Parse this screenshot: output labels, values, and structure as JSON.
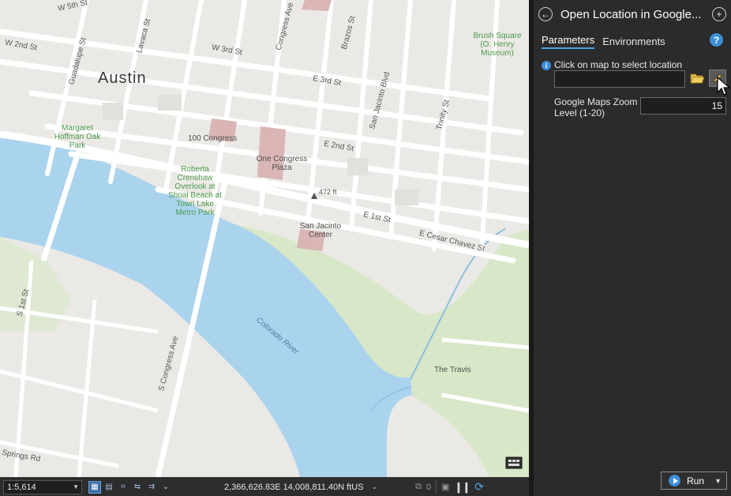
{
  "map": {
    "city": "Austin",
    "streets": [
      "W 5th St",
      "W 2nd St",
      "W 3rd St",
      "E 3rd St",
      "E 2nd St",
      "E 1st St",
      "E Cesar Chavez St",
      "Congress Ave",
      "S Congress Ave",
      "Guadalupe St",
      "Lavaca St",
      "Brazos St",
      "San Jacinto Blvd",
      "Trinity St",
      "S 1st St",
      "Springs Rd"
    ],
    "pois": [
      "100 Congress",
      "One Congress Plaza",
      "San Jacinto Center",
      "The Travis",
      "472 ft"
    ],
    "parks": [
      "Brush Square (O. Henry Museum)",
      "Margaret Hoffman Oak Park",
      "Roberta Crenshaw Overlook at Shoal Beach at Town Lake Metro Park"
    ],
    "river": "Colorado River"
  },
  "statusbar": {
    "scale": "1:5,614",
    "coordinates": "2,366,626.83E 14,008,811.40N ftUS",
    "selected_count": "0"
  },
  "pane": {
    "title": "Open Location in Google...",
    "tabs": [
      "Parameters",
      "Environments"
    ],
    "param1_label": "Click on map to select location",
    "param1_value": "",
    "param2_label": "Google Maps Zoom Level (1-20)",
    "param2_value": "15",
    "run_label": "Run"
  },
  "colors": {
    "accent": "#3b8fd9",
    "water": "#aad3ee",
    "park": "#cfe3b8",
    "pane_bg": "#2b2b2b"
  }
}
